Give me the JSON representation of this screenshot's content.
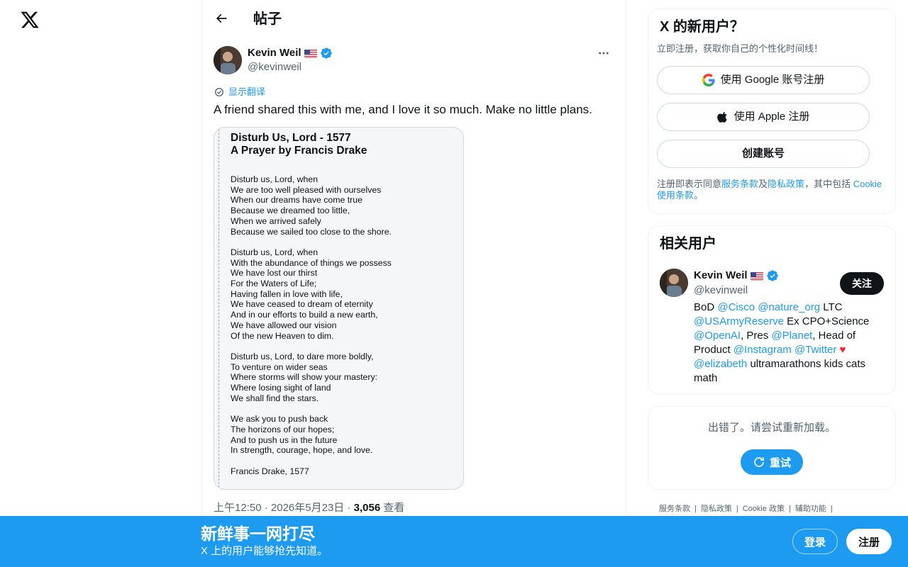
{
  "nav": {
    "logo_icon": "x-logo-icon"
  },
  "header": {
    "title": "帖子",
    "back_icon": "arrow-left-icon"
  },
  "tweet": {
    "author_name": "Kevin Weil",
    "author_handle": "@kevinweil",
    "translate_label": "显示翻译",
    "text": "A friend shared this with me, and I love it so much. Make no little plans.",
    "image": {
      "title_line1": "Disturb Us, Lord - 1577",
      "title_line2": "A Prayer by Francis Drake",
      "stanzas": [
        [
          "Disturb us, Lord, when",
          "We are too well pleased with ourselves",
          "When our dreams have come true",
          "Because we dreamed too little,",
          "When we arrived safely",
          "Because we sailed too close to the shore."
        ],
        [
          "Disturb us, Lord, when",
          "With the abundance of things we possess",
          "We have lost our thirst",
          "For the Waters of Life;",
          "Having fallen in love with life,",
          "We have ceased to dream of eternity",
          "And in our efforts to build a new earth,",
          "We have allowed our vision",
          "Of the new Heaven to dim."
        ],
        [
          "Disturb us, Lord, to dare more boldly,",
          "To venture on wider seas",
          "Where storms will show your mastery:",
          "Where losing sight of land",
          "We shall find the stars."
        ],
        [
          "We ask you to push back",
          "The horizons of our hopes;",
          "And to push us in the future",
          "In strength, courage, hope, and love."
        ],
        [
          "Francis Drake, 1577"
        ]
      ]
    },
    "time": "上午12:50",
    "date": "2026年5月23日",
    "sep": "·",
    "views": "3,056",
    "views_label": "查看"
  },
  "signup_card": {
    "title": "X 的新用户？",
    "subtitle": "立即注册，获取你自己的个性化时间线！",
    "google_label": "使用 Google 账号注册",
    "apple_label": "使用 Apple 注册",
    "create_label": "创建账号",
    "terms_prefix": "注册即表示同意",
    "terms_link": "服务条款",
    "terms_and": "及",
    "privacy_link": "隐私政策",
    "terms_mid": "，其中包括 ",
    "cookie_link": "Cookie 使用条款",
    "terms_end": "。"
  },
  "related": {
    "title": "相关用户",
    "name": "Kevin Weil",
    "handle": "@kevinweil",
    "follow_label": "关注",
    "bio": {
      "t1": "BoD ",
      "m1": "@Cisco",
      "t2": " ",
      "m2": "@nature_org",
      "t3": " LTC ",
      "m3": "@USArmyReserve",
      "t4": " Ex CPO+Science ",
      "m4": "@OpenAI",
      "t5": ", Pres ",
      "m5": "@Planet",
      "t6": ", Head of Product ",
      "m6": "@Instagram",
      "t7": " ",
      "m7": "@Twitter",
      "t8": " ",
      "m8": "@elizabeth",
      "t9": " ultramarathons kids cats math"
    }
  },
  "error_card": {
    "message": "出错了。请尝试重新加载。",
    "retry_label": "重试"
  },
  "footer": {
    "links": [
      "服务条款",
      "隐私政策",
      "Cookie 政策",
      "辅助功能"
    ],
    "sep": "|"
  },
  "banner": {
    "title": "新鲜事一网打尽",
    "subtitle": "X 上的用户能够抢先知道。",
    "login_label": "登录",
    "signup_label": "注册"
  },
  "colors": {
    "accent": "#1d9bf0",
    "text": "#0f1419",
    "muted": "#536471"
  }
}
